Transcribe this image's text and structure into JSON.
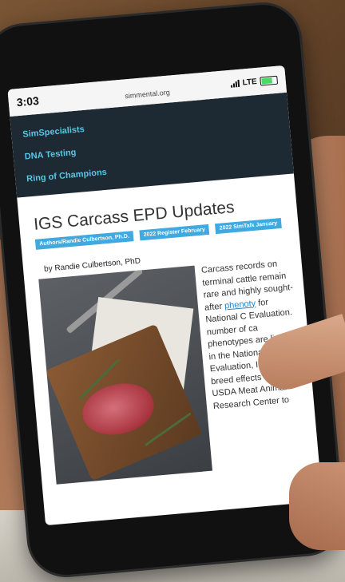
{
  "status": {
    "time": "3:03",
    "network": "LTE",
    "url": "simmental.org"
  },
  "menu": {
    "items": [
      "SimSpecialists",
      "DNA Testing",
      "Ring of Champions"
    ]
  },
  "article": {
    "title": "IGS Carcass EPD Updates",
    "tags": [
      "Authors/Randie Culbertson, Ph.D.",
      "2022 Register February",
      "2022 SimTalk January"
    ],
    "byline": "by Randie Culbertson, PhD",
    "body_before_link": "Carcass records on terminal cattle remain rare and highly sought-after ",
    "link_text": "phenoty",
    "body_after_link": " for National C Evaluation. number of ca phenotypes are limited in the National Cattle Evaluation, IGS uses breed effects from the USDA Meat Animal Research Center to"
  },
  "colors": {
    "menu_bg": "#1e2a33",
    "menu_link": "#55c6e6",
    "tag_bg": "#3fa9e0"
  }
}
